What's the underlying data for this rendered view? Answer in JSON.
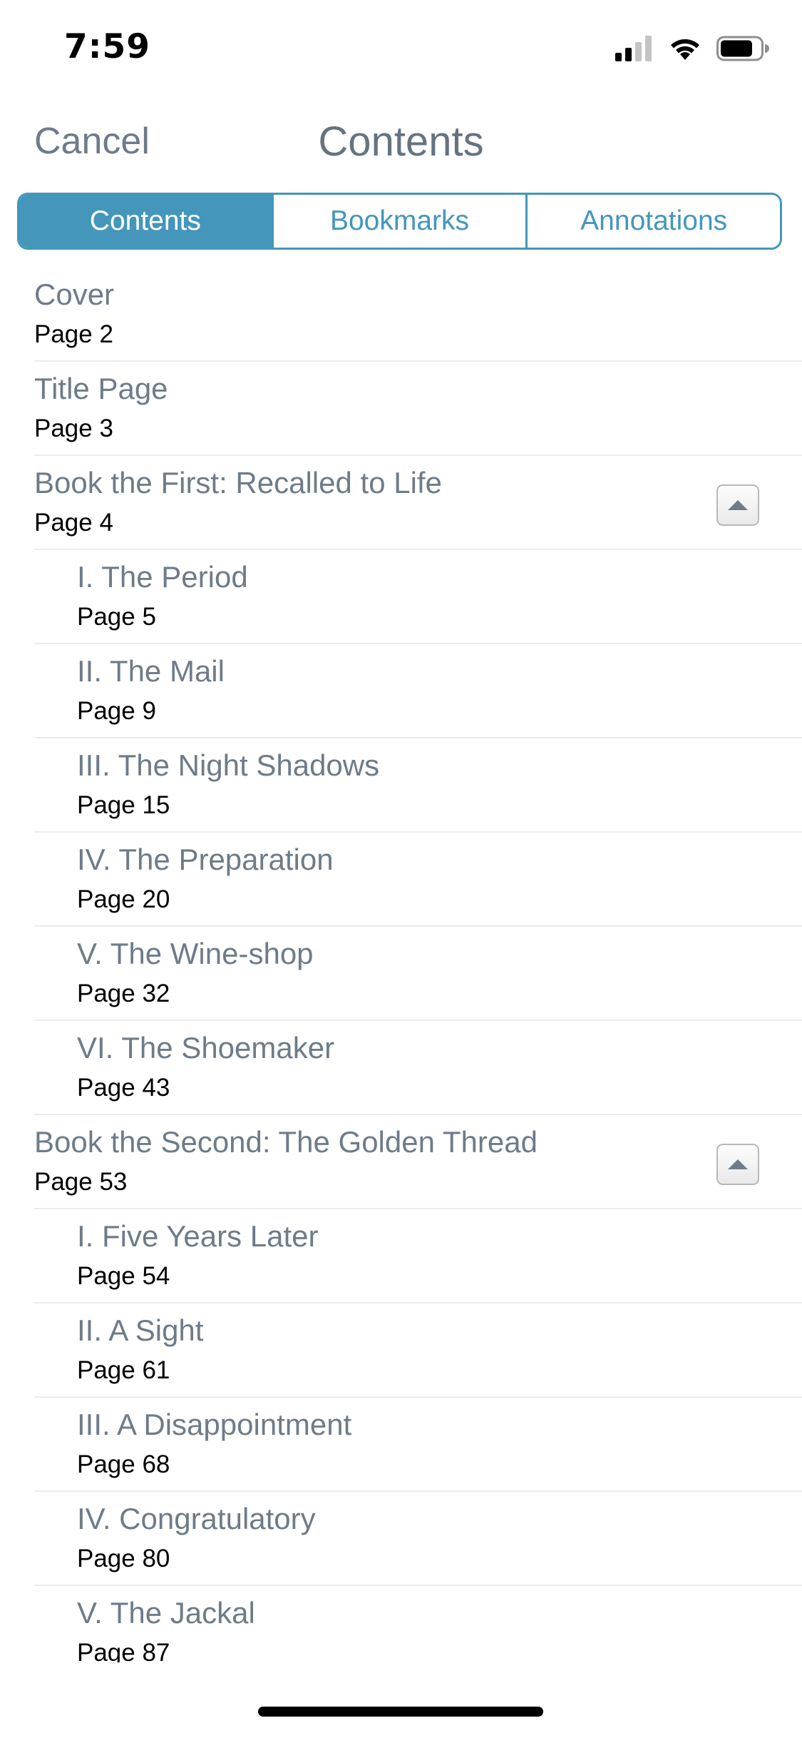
{
  "status_bar": {
    "time": "7:59",
    "icons": [
      "cellular-signal-icon",
      "wifi-icon",
      "battery-icon"
    ]
  },
  "nav": {
    "cancel_label": "Cancel",
    "title": "Contents"
  },
  "tabs": [
    {
      "label": "Contents",
      "active": true
    },
    {
      "label": "Bookmarks",
      "active": false
    },
    {
      "label": "Annotations",
      "active": false
    }
  ],
  "toc": [
    {
      "title": "Cover",
      "page": "Page 2",
      "level": 0,
      "collapsible": false
    },
    {
      "title": "Title Page",
      "page": "Page 3",
      "level": 0,
      "collapsible": false
    },
    {
      "title": "Book the First: Recalled to Life",
      "page": "Page 4",
      "level": 0,
      "collapsible": true
    },
    {
      "title": "I. The Period",
      "page": "Page 5",
      "level": 1,
      "collapsible": false
    },
    {
      "title": "II. The Mail",
      "page": "Page 9",
      "level": 1,
      "collapsible": false
    },
    {
      "title": "III. The Night Shadows",
      "page": "Page 15",
      "level": 1,
      "collapsible": false
    },
    {
      "title": "IV. The Preparation",
      "page": "Page 20",
      "level": 1,
      "collapsible": false
    },
    {
      "title": "V. The Wine-shop",
      "page": "Page 32",
      "level": 1,
      "collapsible": false
    },
    {
      "title": "VI. The Shoemaker",
      "page": "Page 43",
      "level": 1,
      "collapsible": false
    },
    {
      "title": "Book the Second: The Golden Thread",
      "page": "Page 53",
      "level": 0,
      "collapsible": true
    },
    {
      "title": "I. Five Years Later",
      "page": "Page 54",
      "level": 1,
      "collapsible": false
    },
    {
      "title": "II. A Sight",
      "page": "Page 61",
      "level": 1,
      "collapsible": false
    },
    {
      "title": "III. A Disappointment",
      "page": "Page 68",
      "level": 1,
      "collapsible": false
    },
    {
      "title": "IV. Congratulatory",
      "page": "Page 80",
      "level": 1,
      "collapsible": false
    },
    {
      "title": "V. The Jackal",
      "page": "Page 87",
      "level": 1,
      "collapsible": false
    }
  ],
  "colors": {
    "accent": "#4496bb",
    "title_text": "#6e7b89",
    "page_text": "#000000",
    "divider": "#ececec"
  }
}
